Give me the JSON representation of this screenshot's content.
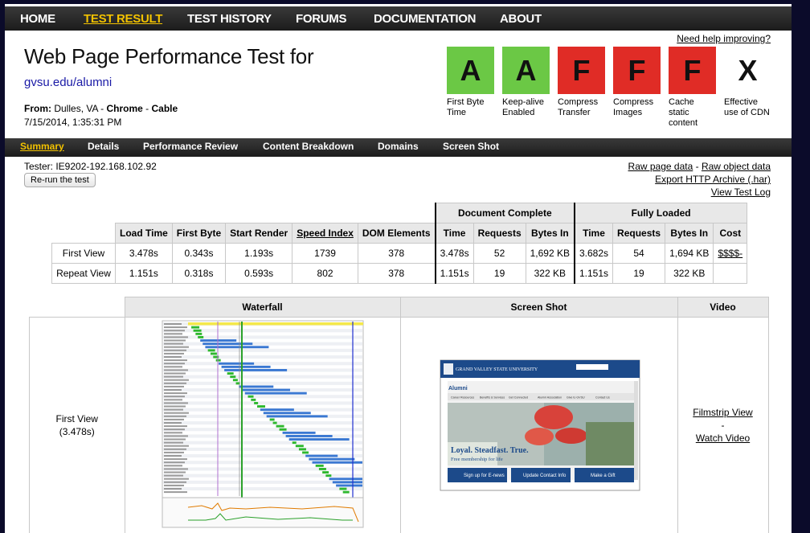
{
  "nav": {
    "items": [
      "HOME",
      "TEST RESULT",
      "TEST HISTORY",
      "FORUMS",
      "DOCUMENTATION",
      "ABOUT"
    ],
    "active": "TEST RESULT"
  },
  "help_link": "Need help improving?",
  "page_title": "Web Page Performance Test for",
  "tested_url": "gvsu.edu/alumni",
  "from_label": "From:",
  "from_location": "Dulles, VA",
  "from_browser": "Chrome",
  "from_connection": "Cable",
  "test_date": "7/15/2014, 1:35:31 PM",
  "grades": [
    {
      "letter": "A",
      "label": "First Byte Time",
      "color": "#6bc845"
    },
    {
      "letter": "A",
      "label": "Keep-alive Enabled",
      "color": "#6bc845"
    },
    {
      "letter": "F",
      "label": "Compress Transfer",
      "color": "#e02c26"
    },
    {
      "letter": "F",
      "label": "Compress Images",
      "color": "#e02c26"
    },
    {
      "letter": "F",
      "label": "Cache static content",
      "color": "#e02c26"
    },
    {
      "letter": "X",
      "label": "Effective use of CDN",
      "color": "#ffffff"
    }
  ],
  "subnav": {
    "items": [
      "Summary",
      "Details",
      "Performance Review",
      "Content Breakdown",
      "Domains",
      "Screen Shot"
    ],
    "active": "Summary"
  },
  "tester": "Tester: IE9202-192.168.102.92",
  "rerun_button": "Re-run the test",
  "right_links": [
    "Raw page data",
    "Raw object data",
    "Export HTTP Archive (.har)",
    "View Test Log"
  ],
  "results": {
    "group_headers": {
      "document_complete": "Document Complete",
      "fully_loaded": "Fully Loaded"
    },
    "columns": [
      "Load Time",
      "First Byte",
      "Start Render",
      "Speed Index",
      "DOM Elements",
      "Time",
      "Requests",
      "Bytes In",
      "Time",
      "Requests",
      "Bytes In",
      "Cost"
    ],
    "rows": [
      {
        "label": "First View",
        "values": [
          "3.478s",
          "0.343s",
          "1.193s",
          "1739",
          "378",
          "3.478s",
          "52",
          "1,692 KB",
          "3.682s",
          "54",
          "1,694 KB",
          "$$$$-"
        ]
      },
      {
        "label": "Repeat View",
        "values": [
          "1.151s",
          "0.318s",
          "0.593s",
          "802",
          "378",
          "1.151s",
          "19",
          "322 KB",
          "1.151s",
          "19",
          "322 KB",
          ""
        ]
      }
    ]
  },
  "bottom": {
    "headers": [
      "Waterfall",
      "Screen Shot",
      "Video"
    ],
    "row_label": "First View",
    "row_time": "(3.478s)",
    "video_links": [
      "Filmstrip View",
      "-",
      "Watch Video"
    ],
    "screenshot": {
      "brand": "GRAND VALLEY STATE UNIVERSITY",
      "section": "Alumni",
      "menu": [
        "Career Resources",
        "Benefits & Services",
        "Get Connected",
        "Alumni Association",
        "Give to GVSU",
        "Contact Us"
      ],
      "hero_title": "Loyal. Steadfast. True.",
      "hero_sub": "Free membership for life",
      "buttons": [
        "Sign up for E-news",
        "Update Contact Info",
        "Make a Gift"
      ]
    }
  }
}
